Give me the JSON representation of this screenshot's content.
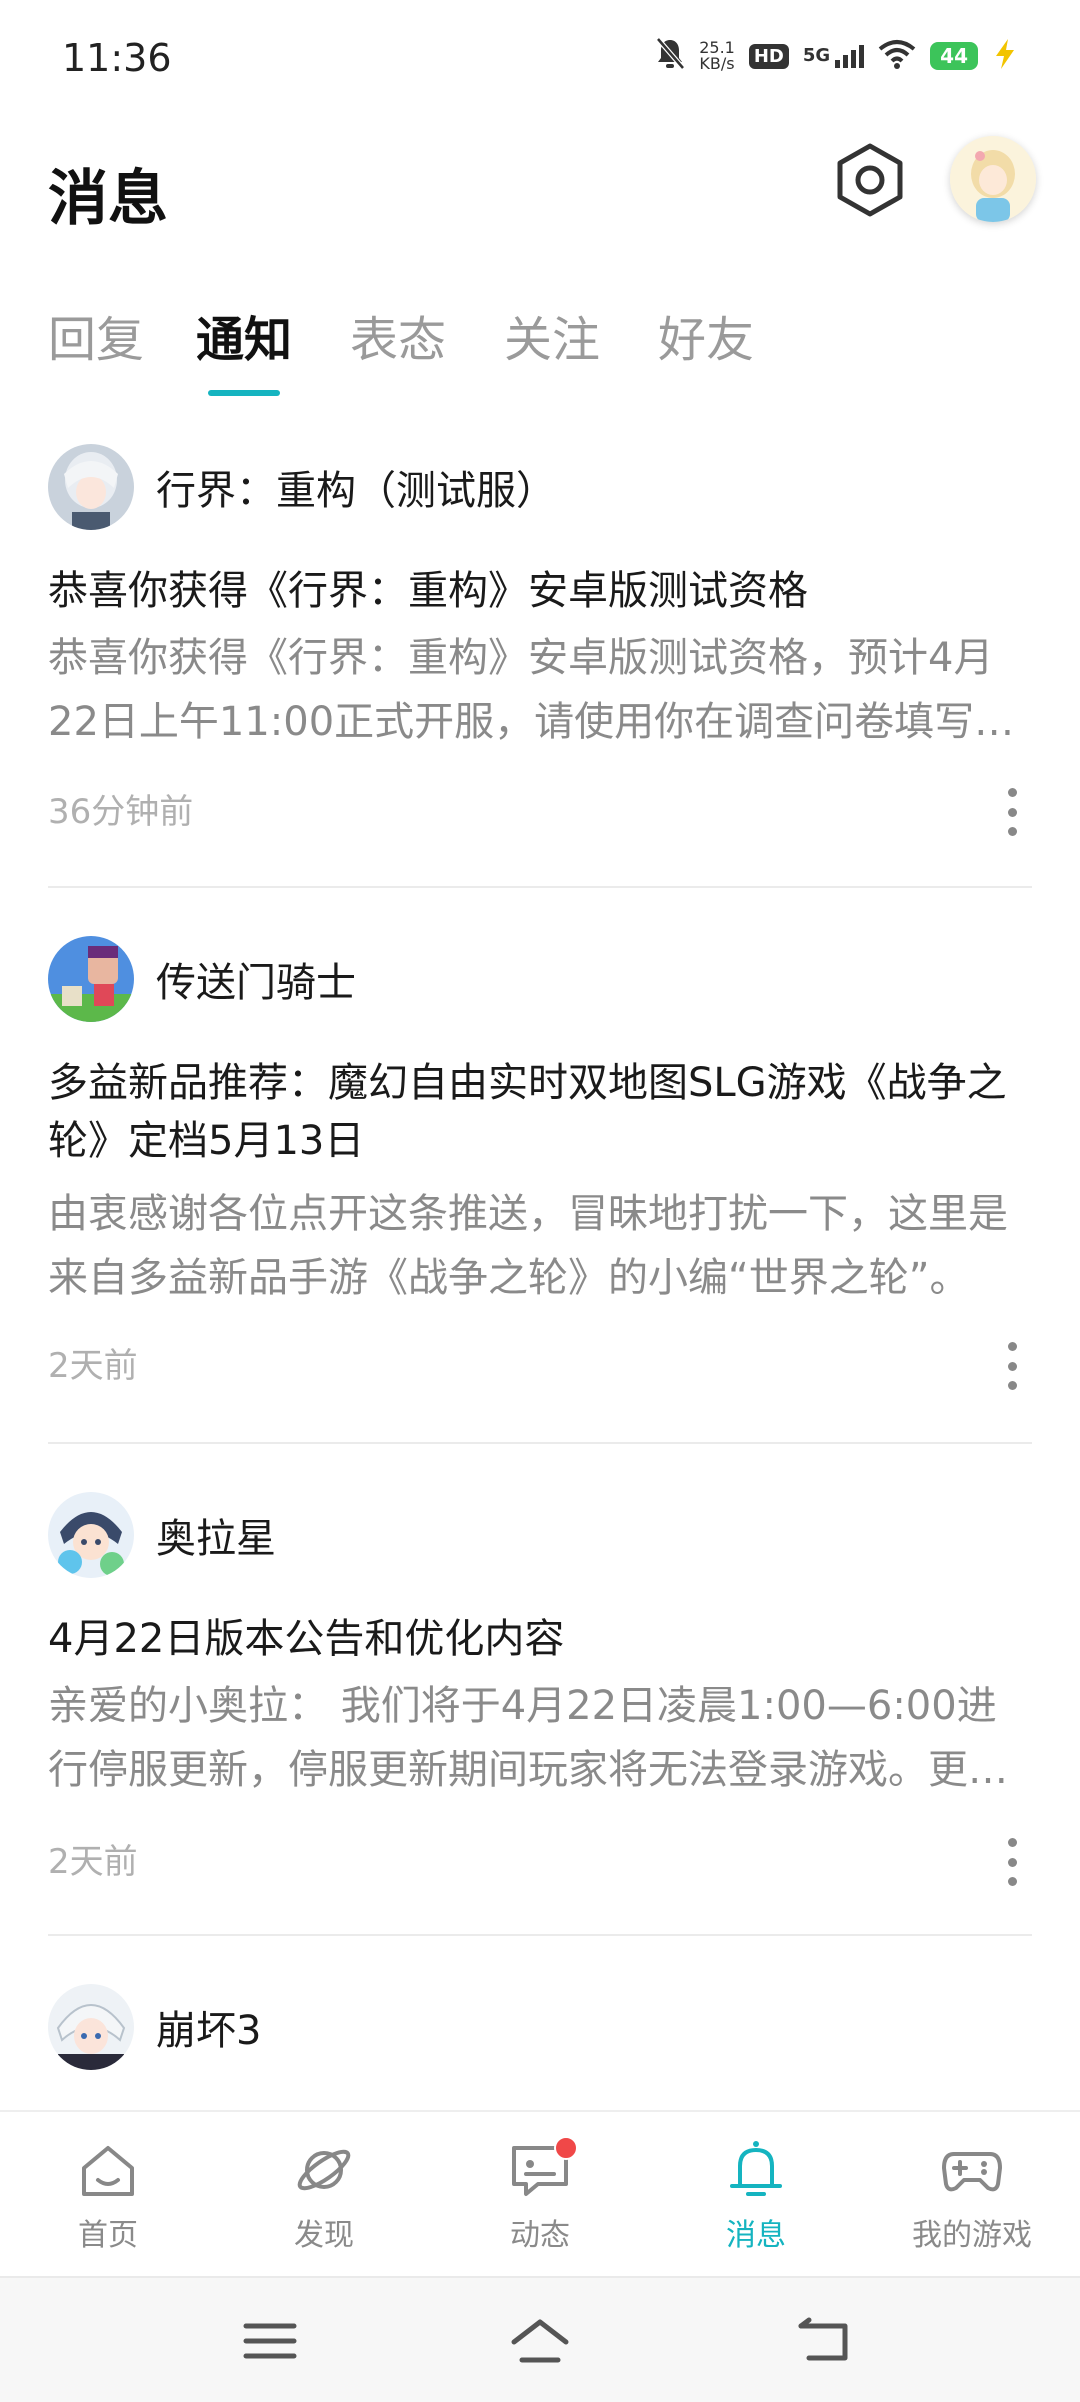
{
  "status_bar": {
    "time": "11:36",
    "net_speed_value": "25.1",
    "net_speed_unit": "KB/s",
    "hd": "HD",
    "signal": "5G",
    "battery": "44"
  },
  "header": {
    "title": "消息"
  },
  "tabs": [
    {
      "label": "回复"
    },
    {
      "label": "通知",
      "active": true
    },
    {
      "label": "表态"
    },
    {
      "label": "关注"
    },
    {
      "label": "好友"
    }
  ],
  "messages": [
    {
      "sender": "行界：重构（测试服）",
      "title": "恭喜你获得《行界：重构》安卓版测试资格",
      "body": "恭喜你获得《行界：重构》安卓版测试资格，预计4月22日上午11:00正式开服，请使用你在调查问卷填写的账号登录游戏。",
      "time": "36分钟前"
    },
    {
      "sender": "传送门骑士",
      "title": "多益新品推荐：魔幻自由实时双地图SLG游戏《战争之轮》定档5月13日",
      "body": "由衷感谢各位点开这条推送，冒昧地打扰一下，这里是来自多益新品手游《战争之轮》的小编“世界之轮”。",
      "time": "2天前"
    },
    {
      "sender": "奥拉星",
      "title": "4月22日版本公告和优化内容",
      "body": "亲爱的小奥拉：  我们将于4月22日凌晨1:00—6:00进行停服更新，停服更新期间玩家将无法登录游戏。更新内容如下。",
      "time": "2天前"
    },
    {
      "sender": "崩坏3"
    }
  ],
  "bottom_nav": [
    {
      "label": "首页",
      "icon": "home-icon"
    },
    {
      "label": "发现",
      "icon": "planet-icon"
    },
    {
      "label": "动态",
      "icon": "chat-icon",
      "badge": true
    },
    {
      "label": "消息",
      "icon": "bell-icon",
      "active": true
    },
    {
      "label": "我的游戏",
      "icon": "gamepad-icon"
    }
  ],
  "colors": {
    "accent": "#15b4c0",
    "badge": "#f04848",
    "inactive_text": "#8a8a8a"
  }
}
